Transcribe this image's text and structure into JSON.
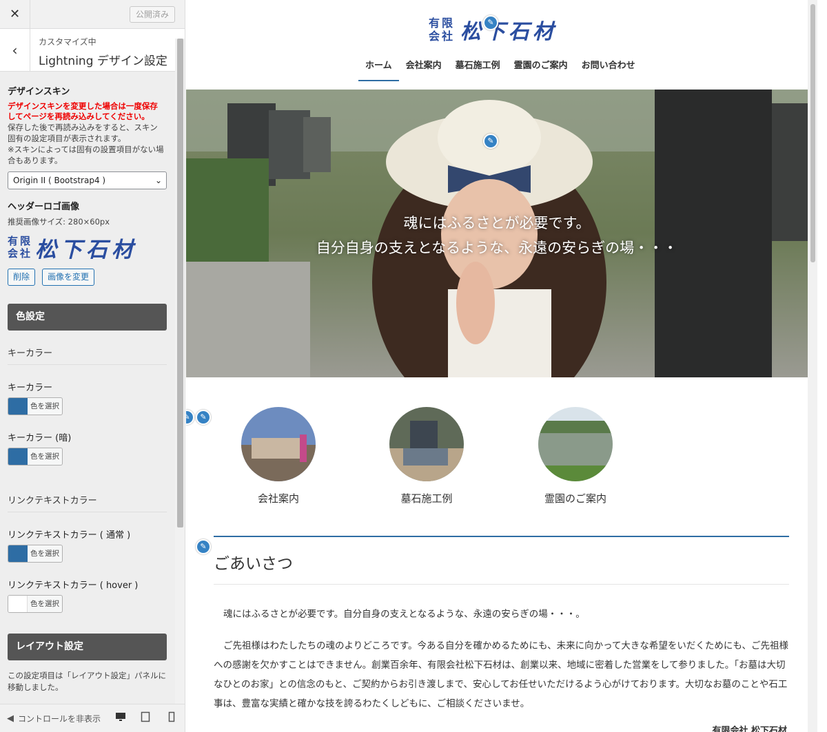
{
  "topbar": {
    "close": "✕",
    "publish_label": "公開済み"
  },
  "panel": {
    "back": "‹",
    "subtitle": "カスタマイズ中",
    "title": "Lightning デザイン設定"
  },
  "design_skin": {
    "label": "デザインスキン",
    "warning": "デザインスキンを変更した場合は一度保存してページを再読み込みしてください。",
    "desc1": "保存した後で再読み込みをすると、スキン固有の設定項目が表示されます。",
    "desc2": "※スキンによっては固有の設置項目がない場合もあります。",
    "selected": "Origin II ( Bootstrap4 )"
  },
  "header_logo": {
    "label": "ヘッダーロゴ画像",
    "size_note": "推奨画像サイズ: 280×60px",
    "logo_small": "有限会社",
    "logo_main": "松下石材",
    "delete_label": "削除",
    "change_label": "画像を変更"
  },
  "color_section": {
    "button_label": "色設定",
    "key_group": "キーカラー",
    "key_color_label": "キーカラー",
    "key_dark_label": "キーカラー (暗)",
    "link_group": "リンクテキストカラー",
    "link_normal_label": "リンクテキストカラー ( 通常 )",
    "link_hover_label": "リンクテキストカラー ( hover )",
    "pick_label": "色を選択",
    "key_color": "#2e6da4",
    "key_dark_color": "#2e6da4",
    "link_color": "#2e6da4",
    "hover_color": "#ffffff"
  },
  "layout_section": {
    "button_label": "レイアウト設定",
    "note": "この設定項目は「レイアウト設定」パネルに移動しました。"
  },
  "footer": {
    "hide_controls": "コントロールを非表示"
  },
  "site": {
    "logo_small": "有限会社",
    "logo_main": "松下石材",
    "nav": [
      "ホーム",
      "会社案内",
      "墓石施工例",
      "霊園のご案内",
      "お問い合わせ"
    ],
    "hero_line1": "魂にはふるさとが必要です。",
    "hero_line2": "自分自身の支えとなるような、永遠の安らぎの場・・・",
    "pr": [
      "会社案内",
      "墓石施工例",
      "霊園のご案内"
    ],
    "greeting_title": "ごあいさつ",
    "para1": "魂にはふるさとが必要です。自分自身の支えとなるような、永遠の安らぎの場・・・。",
    "para2": "ご先祖様はわたしたちの魂のよりどころです。今ある自分を確かめるためにも、未来に向かって大きな希望をいだくためにも、ご先祖様への感謝を欠かすことはできません。創業百余年、有限会社松下石材は、創業以来、地域に密着した営業をして参りました。「お墓は大切なひとのお家」との信念のもと、ご契約からお引き渡しまで、安心してお任せいただけるよう心がけております。大切なお墓のことや石工事は、豊富な実績と確かな技を誇るわたくしどもに、ご相談くださいませ。",
    "signature": "有限会社 松下石材"
  }
}
